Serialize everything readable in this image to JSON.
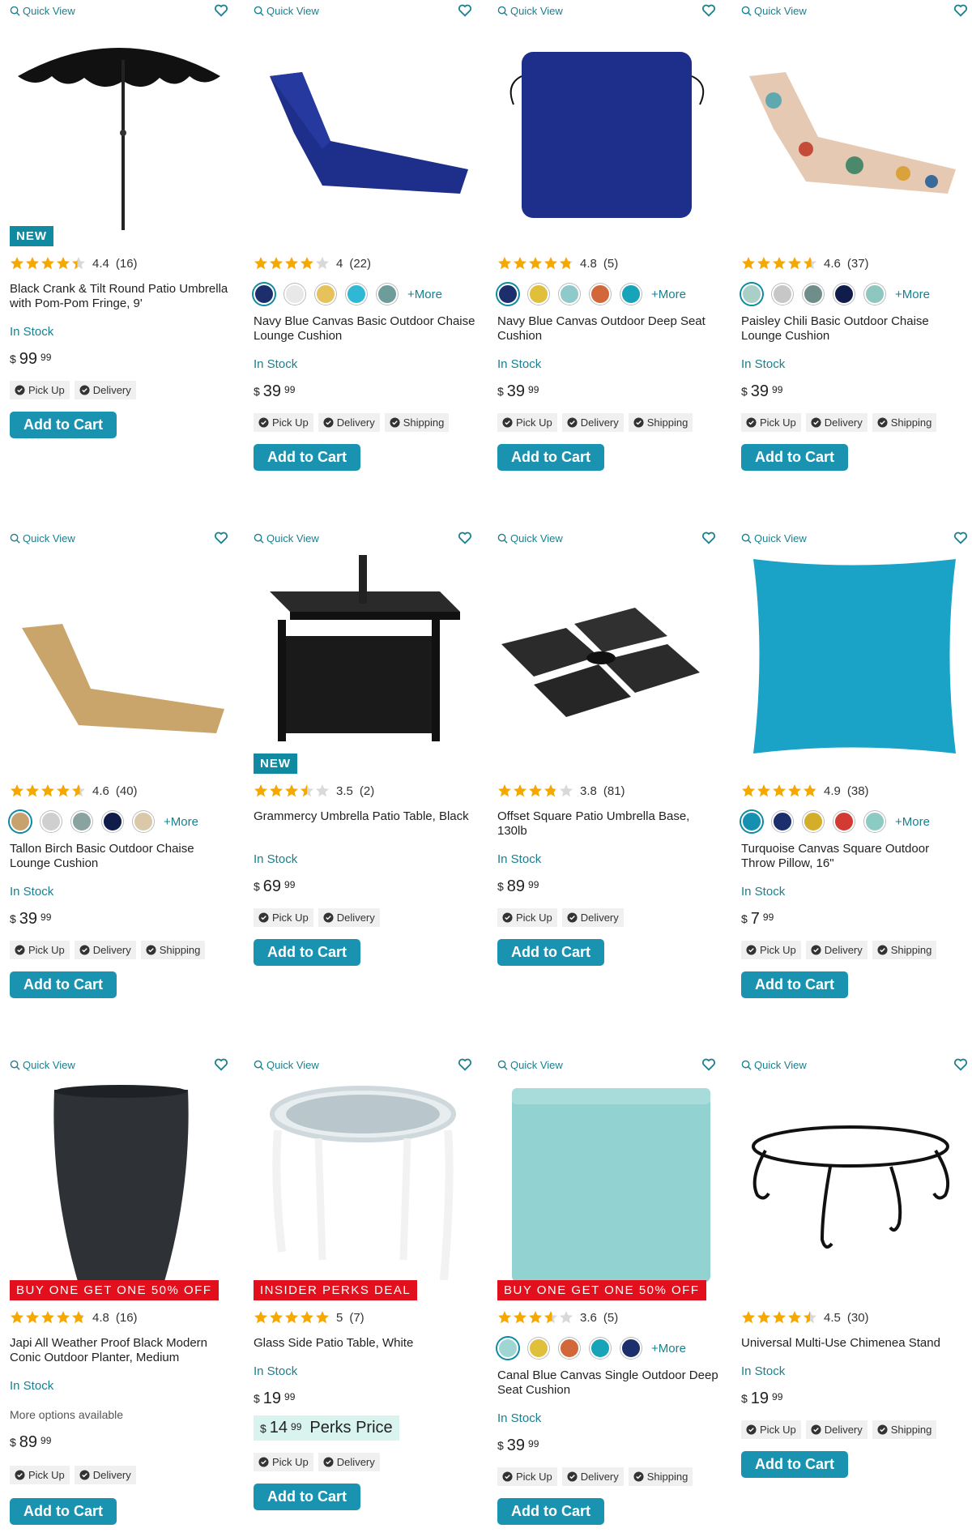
{
  "common": {
    "quick_view": "Quick View",
    "add_to_cart": "Add to Cart",
    "pick_up": "Pick Up",
    "delivery": "Delivery",
    "shipping": "Shipping",
    "in_stock": "In Stock",
    "more": "+More",
    "currency": "$"
  },
  "products": [
    {
      "badge": "NEW",
      "rating": "4.4",
      "reviews": "(16)",
      "title": "Black Crank & Tilt Round Patio Umbrella with Pom-Pom Fringe, 9'",
      "dollars": "99",
      "cents": "99",
      "stars": 4.4
    },
    {
      "rating": "4",
      "reviews": "(22)",
      "title": "Navy Blue Canvas Basic Outdoor Chaise Lounge Cushion",
      "dollars": "39",
      "cents": "99",
      "stars": 4,
      "swatches": [
        "#1c2e6b",
        "#e8e8e8",
        "#e6c25a",
        "#2fb8d6",
        "#6e9c9a"
      ]
    },
    {
      "rating": "4.8",
      "reviews": "(5)",
      "title": "Navy Blue Canvas Outdoor Deep Seat Cushion",
      "dollars": "39",
      "cents": "99",
      "stars": 4.8,
      "swatches": [
        "#1c2e6b",
        "#e0bf3a",
        "#8fc9c9",
        "#d2683a",
        "#17a3b8"
      ]
    },
    {
      "rating": "4.6",
      "reviews": "(37)",
      "title": "Paisley Chili Basic Outdoor Chaise Lounge Cushion",
      "dollars": "39",
      "cents": "99",
      "stars": 4.6,
      "swatches": [
        "#a9cfc6",
        "#c7c7c7",
        "#6f8d8a",
        "#101c4a",
        "#8ec6c0"
      ]
    },
    {
      "rating": "4.6",
      "reviews": "(40)",
      "title": "Tallon Birch Basic Outdoor Chaise Lounge Cushion",
      "dollars": "39",
      "cents": "99",
      "stars": 4.6,
      "swatches": [
        "#c8a26e",
        "#cfcfcf",
        "#8aa3a0",
        "#101c4a",
        "#d9c9a8"
      ]
    },
    {
      "badge": "NEW",
      "rating": "3.5",
      "reviews": "(2)",
      "title": "Grammercy Umbrella Patio Table, Black",
      "dollars": "69",
      "cents": "99",
      "stars": 3.5
    },
    {
      "rating": "3.8",
      "reviews": "(81)",
      "title": "Offset Square Patio Umbrella Base, 130lb",
      "dollars": "89",
      "cents": "99",
      "stars": 3.8
    },
    {
      "rating": "4.9",
      "reviews": "(38)",
      "title": "Turquoise Canvas Square Outdoor Throw Pillow, 16\"",
      "dollars": "7",
      "cents": "99",
      "stars": 4.9,
      "swatches": [
        "#1590b0",
        "#1c2e6b",
        "#d4ad2a",
        "#d23a33",
        "#8ccac4"
      ]
    },
    {
      "promo": "BUY ONE GET ONE 50% OFF",
      "rating": "4.8",
      "reviews": "(16)",
      "title": "Japi All Weather Proof Black Modern Conic Outdoor Planter, Medium",
      "more_options": "More options available",
      "dollars": "89",
      "cents": "99",
      "stars": 4.8
    },
    {
      "promo": "INSIDER PERKS DEAL",
      "rating": "5",
      "reviews": "(7)",
      "title": "Glass Side Patio Table, White",
      "dollars": "19",
      "cents": "99",
      "stars": 5,
      "perks_dollars": "14",
      "perks_cents": "99",
      "perks_label": "Perks Price"
    },
    {
      "promo": "BUY ONE GET ONE 50% OFF",
      "rating": "3.6",
      "reviews": "(5)",
      "title": "Canal Blue Canvas Single Outdoor Deep Seat Cushion",
      "dollars": "39",
      "cents": "99",
      "stars": 3.6,
      "swatches": [
        "#9fd6d3",
        "#e0bf3a",
        "#d2683a",
        "#17a3b8",
        "#1c2e6b"
      ]
    },
    {
      "rating": "4.5",
      "reviews": "(30)",
      "title": "Universal Multi-Use Chimenea Stand",
      "dollars": "19",
      "cents": "99",
      "stars": 4.5
    }
  ]
}
